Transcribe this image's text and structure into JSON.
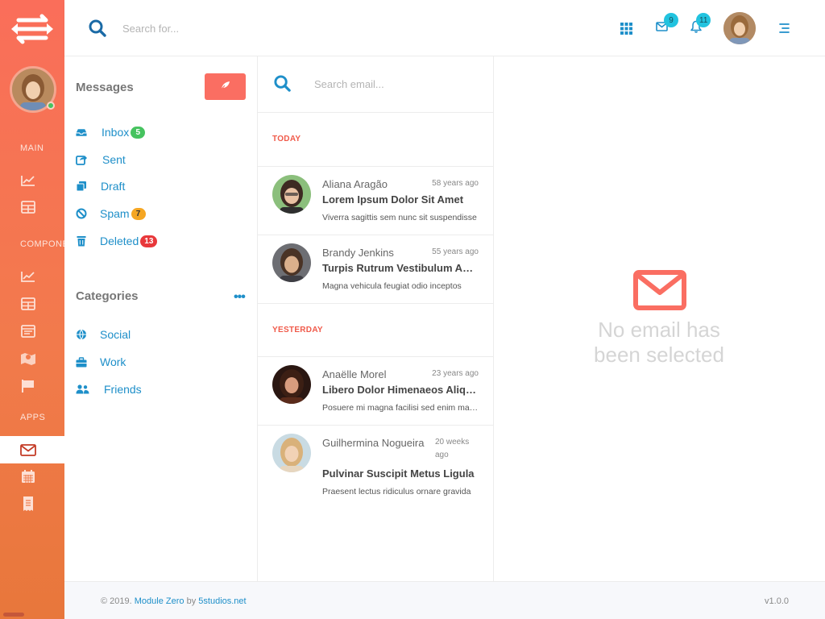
{
  "colors": {
    "accent": "#fa6e62",
    "link": "#1e8fc9",
    "sidebar_top": "#fa6e5a",
    "sidebar_bottom": "#e8773b",
    "badge_cyan": "#22c3df"
  },
  "sidebar": {
    "sections": [
      {
        "label": "MAIN",
        "icons": [
          "line-chart-icon",
          "table-icon"
        ]
      },
      {
        "label": "COMPONENTS",
        "icons": [
          "line-chart-icon",
          "table-icon",
          "browser-icon",
          "map-icon",
          "flag-icon"
        ]
      },
      {
        "label": "APPS",
        "icons": [
          "mail-icon",
          "calendar-icon",
          "receipt-icon"
        ]
      }
    ],
    "active_item": "mail-icon"
  },
  "header": {
    "search_placeholder": "Search for...",
    "mail_count": "9",
    "notification_count": "11"
  },
  "messages": {
    "title": "Messages",
    "folders": [
      {
        "label": "Inbox",
        "count": "5",
        "count_color": "#46c35f",
        "count_text_color": "#ffffff",
        "icon": "inbox-icon"
      },
      {
        "label": "Sent",
        "count": "",
        "icon": "share-icon"
      },
      {
        "label": "Draft",
        "count": "",
        "icon": "copy-icon"
      },
      {
        "label": "Spam",
        "count": "7",
        "count_color": "#f5a623",
        "count_text_color": "#333333",
        "icon": "ban-icon"
      },
      {
        "label": "Deleted",
        "count": "13",
        "count_color": "#e8383b",
        "count_text_color": "#ffffff",
        "icon": "trash-icon"
      }
    ],
    "categories_title": "Categories",
    "categories": [
      {
        "label": "Social",
        "icon": "globe-icon"
      },
      {
        "label": "Work",
        "icon": "briefcase-icon"
      },
      {
        "label": "Friends",
        "icon": "users-icon"
      }
    ]
  },
  "email_list": {
    "search_placeholder": "Search email...",
    "groups": [
      {
        "label": "TODAY",
        "emails": [
          {
            "from": "Aliana Aragão",
            "time": "58 years ago",
            "subject": "Lorem Ipsum Dolor Sit Amet",
            "preview": "Viverra sagittis sem nunc sit suspendisse"
          },
          {
            "from": "Brandy Jenkins",
            "time": "55 years ago",
            "subject": "Turpis Rutrum Vestibulum Augue",
            "preview": "Magna vehicula feugiat odio inceptos"
          }
        ]
      },
      {
        "label": "YESTERDAY",
        "emails": [
          {
            "from": "Anaëlle Morel",
            "time": "23 years ago",
            "subject": "Libero Dolor Himenaeos Aliquam",
            "preview": "Posuere mi magna facilisi sed enim mauris"
          },
          {
            "from": "Guilhermina Nogueira",
            "time": "20 weeks ago",
            "subject": "Pulvinar Suscipit Metus Ligula",
            "preview": "Praesent lectus ridiculus ornare gravida"
          }
        ]
      }
    ]
  },
  "detail": {
    "empty_text": "No email has been selected"
  },
  "footer": {
    "copyright": "© 2019.",
    "brand": "Module Zero",
    "by": "by",
    "studio": "5studios.net",
    "version": "v1.0.0"
  }
}
